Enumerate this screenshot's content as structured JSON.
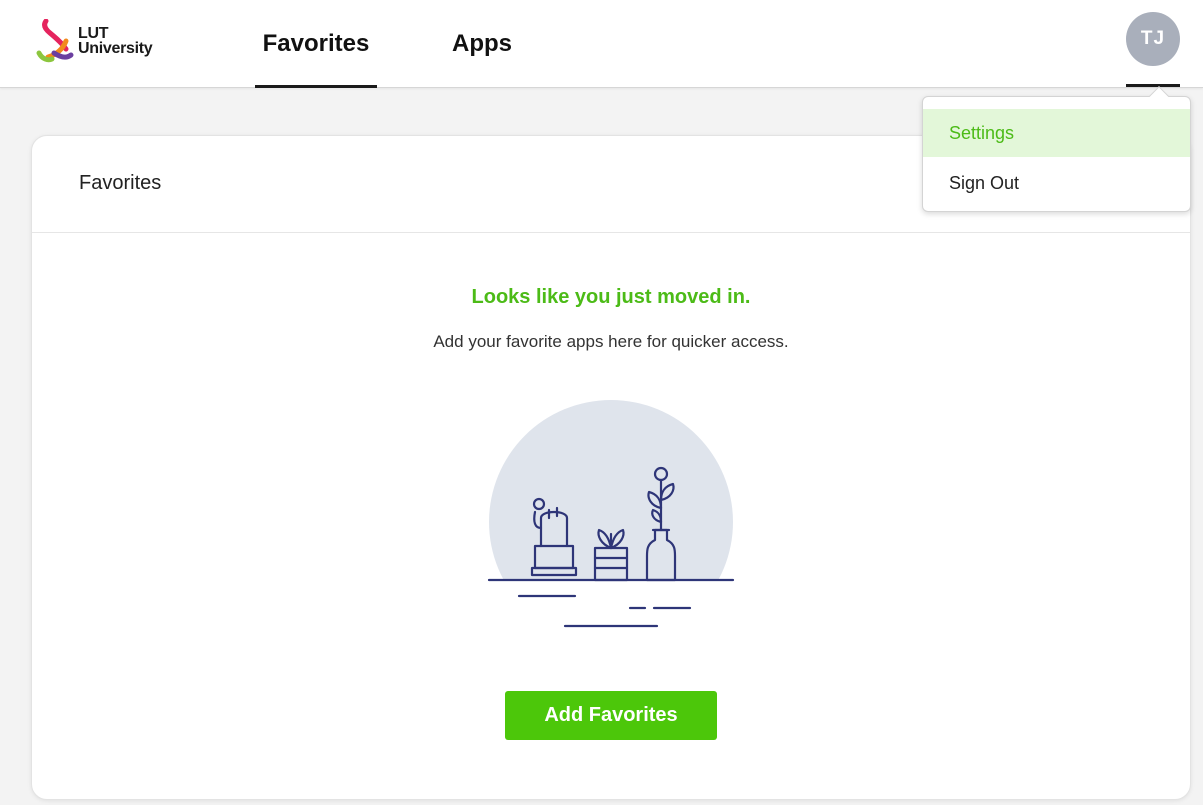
{
  "header": {
    "logo_line1": "LUT",
    "logo_line2": "University",
    "tabs": [
      {
        "label": "Favorites",
        "active": true
      },
      {
        "label": "Apps",
        "active": false
      }
    ],
    "avatar_initials": "TJ"
  },
  "dropdown": {
    "items": [
      {
        "label": "Settings",
        "highlighted": true
      },
      {
        "label": "Sign Out",
        "highlighted": false
      }
    ]
  },
  "card": {
    "title": "Favorites",
    "empty_title": "Looks like you just moved in.",
    "empty_subtitle": "Add your favorite apps here for quicker access.",
    "add_button_label": "Add Favorites"
  },
  "colors": {
    "accent_green": "#4cbb17",
    "button_green": "#4cc70a",
    "highlight_bg": "#e3f7d9",
    "illustration_navy": "#2e3578",
    "illustration_circle": "#dfe4ec",
    "avatar_bg": "#a9afbb"
  }
}
